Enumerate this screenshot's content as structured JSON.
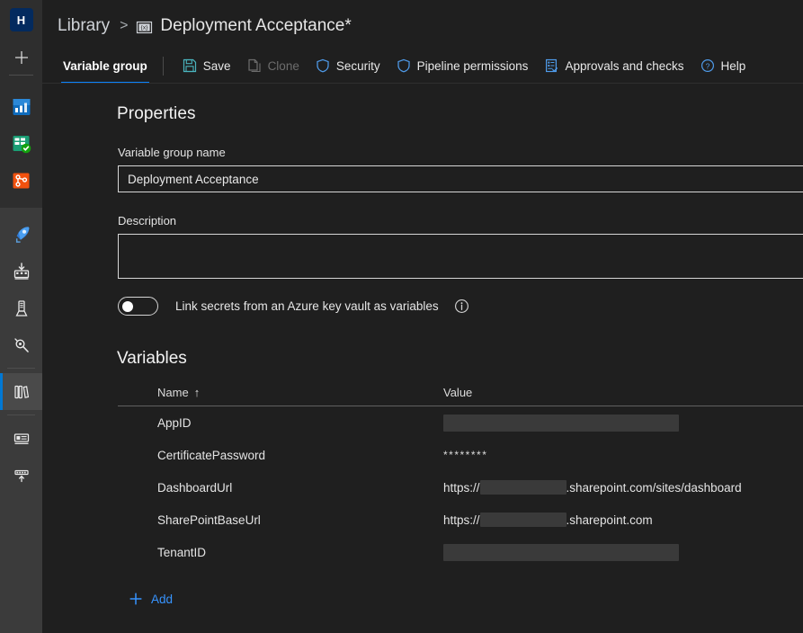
{
  "rail": {
    "avatar_label": "H",
    "new_label": "+",
    "items": [
      {
        "name": "overview-icon",
        "label": "Overview"
      },
      {
        "name": "boards-icon",
        "label": "Boards"
      },
      {
        "name": "repos-icon",
        "label": "Repos"
      },
      {
        "name": "pipelines-rocket-icon",
        "label": "Pipelines"
      },
      {
        "name": "pipelines-builds-icon",
        "label": "Builds"
      },
      {
        "name": "releases-icon",
        "label": "Releases"
      },
      {
        "name": "environments-icon",
        "label": "Environments"
      },
      {
        "name": "library-icon",
        "label": "Library"
      },
      {
        "name": "task-groups-icon",
        "label": "Task groups"
      },
      {
        "name": "deployment-groups-icon",
        "label": "Deployment groups"
      }
    ]
  },
  "breadcrumb": {
    "root": "Library",
    "separator": ">",
    "variable_icon": "{x}",
    "title": "Deployment Acceptance*"
  },
  "toolbar": {
    "tab_label": "Variable group",
    "buttons": [
      {
        "label": "Save",
        "icon": "save-icon",
        "disabled": false
      },
      {
        "label": "Clone",
        "icon": "clone-icon",
        "disabled": true
      },
      {
        "label": "Security",
        "icon": "shield-icon",
        "disabled": false
      },
      {
        "label": "Pipeline permissions",
        "icon": "shield-icon",
        "disabled": false
      },
      {
        "label": "Approvals and checks",
        "icon": "checklist-icon",
        "disabled": false
      },
      {
        "label": "Help",
        "icon": "help-circle-icon",
        "disabled": false
      }
    ]
  },
  "properties": {
    "heading": "Properties",
    "name_label": "Variable group name",
    "name_value": "Deployment Acceptance",
    "description_label": "Description",
    "description_value": "",
    "keyvault_toggle_label": "Link secrets from an Azure key vault as variables",
    "keyvault_toggle_state": "off"
  },
  "variables": {
    "heading": "Variables",
    "columns": {
      "name": "Name",
      "sort_arrow": "↑",
      "value": "Value"
    },
    "rows": [
      {
        "name": "AppID",
        "value_type": "redacted-block",
        "value": ""
      },
      {
        "name": "CertificatePassword",
        "value_type": "masked",
        "value": "********"
      },
      {
        "name": "DashboardUrl",
        "value_type": "url-redacted",
        "prefix": "https://",
        "suffix": ".sharepoint.com/sites/dashboard"
      },
      {
        "name": "SharePointBaseUrl",
        "value_type": "url-redacted",
        "prefix": "https://",
        "suffix": ".sharepoint.com"
      },
      {
        "name": "TenantID",
        "value_type": "redacted-block",
        "value": ""
      }
    ],
    "add_label": "Add",
    "add_icon": "plus-icon"
  },
  "colors": {
    "accent": "#0078d4",
    "link": "#3794ff",
    "background": "#1f1f1f",
    "rail": "#3b3b3b",
    "rail_dark": "#2e2e2e",
    "avatar": "#032a5e"
  }
}
